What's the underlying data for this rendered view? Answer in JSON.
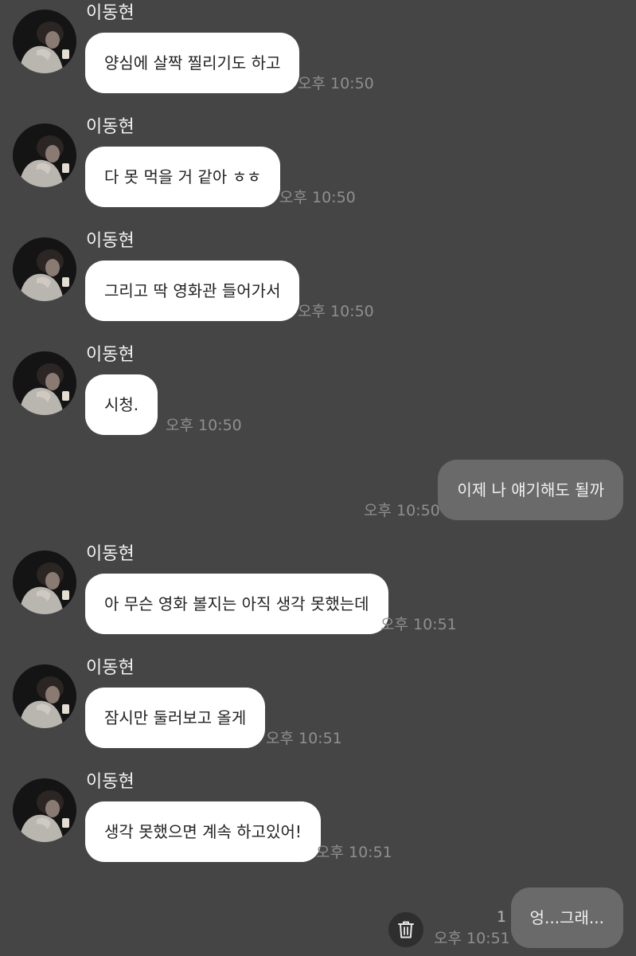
{
  "chat": {
    "messages": [
      {
        "sender": "이동현",
        "text": "양심에 살짝 찔리기도 하고",
        "time": "오후 10:50"
      },
      {
        "sender": "이동현",
        "text": "다 못 먹을 거 같아 ㅎㅎ",
        "time": "오후 10:50"
      },
      {
        "sender": "이동현",
        "text": "그리고 딱 영화관 들어가서",
        "time": "오후 10:50"
      },
      {
        "sender": "이동현",
        "text": "시청.",
        "time": "오후 10:50"
      },
      {
        "sender": "",
        "text": "이제 나 얘기해도 될까",
        "time": "오후 10:50"
      },
      {
        "sender": "이동현",
        "text": "아 무슨 영화 볼지는 아직 생각 못했는데",
        "time": "오후 10:51"
      },
      {
        "sender": "이동현",
        "text": "잠시만 둘러보고 올게",
        "time": "오후 10:51"
      },
      {
        "sender": "이동현",
        "text": "생각 못했으면 계속 하고있어!",
        "time": "오후 10:51"
      },
      {
        "sender": "",
        "text": "엉...그래...",
        "time": "오후 10:51",
        "unread_count": "1"
      }
    ]
  },
  "icons": {
    "avatar": "profile-photo",
    "delete": "trash-icon"
  },
  "colors": {
    "background": "#454545",
    "incoming_bubble": "#ffffff",
    "outgoing_bubble": "#6a6a6a",
    "timestamp": "#8f8f8f"
  }
}
